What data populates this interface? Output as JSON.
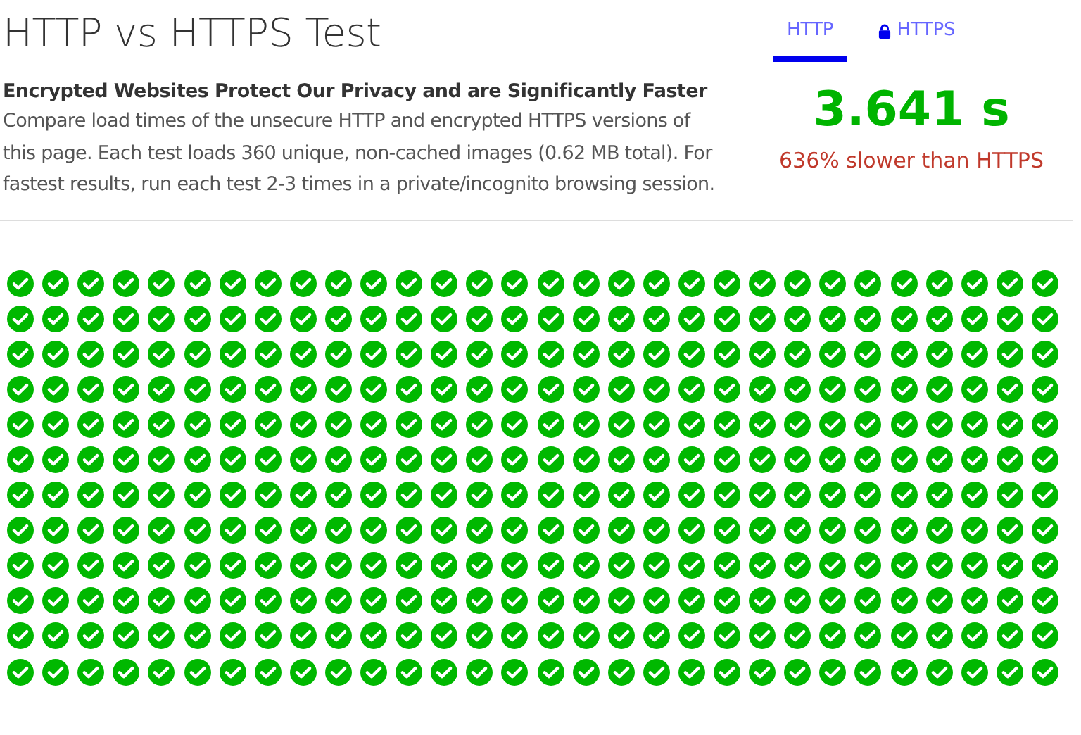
{
  "title": "HTTP vs HTTPS Test",
  "intro": {
    "heading": "Encrypted Websites Protect Our Privacy and are Significantly Faster",
    "body": "Compare load times of the unsecure HTTP and encrypted HTTPS versions of this page. Each test loads 360 unique, non-cached images (0.62 MB total). For fastest results, run each test 2-3 times in a private/incognito browsing session."
  },
  "tabs": [
    {
      "label": "HTTP",
      "kind": "plain",
      "selected": true
    },
    {
      "label": "HTTPS",
      "kind": "secure",
      "selected": false
    }
  ],
  "result": {
    "time": "3.641 s",
    "comparison": "636% slower than HTTPS"
  },
  "image_rows": [
    {
      "loaded": [
        true,
        true,
        true,
        true,
        true,
        true,
        true,
        true,
        true,
        true,
        true,
        true,
        true,
        true,
        true,
        true,
        true,
        true,
        true,
        true,
        true,
        true,
        true,
        true,
        true,
        true,
        true,
        true,
        true,
        true
      ]
    },
    {
      "loaded": [
        true,
        true,
        true,
        true,
        true,
        true,
        true,
        true,
        true,
        true,
        true,
        true,
        true,
        true,
        true,
        true,
        true,
        true,
        true,
        true,
        true,
        true,
        true,
        true,
        true,
        true,
        true,
        true,
        true,
        true
      ]
    },
    {
      "loaded": [
        true,
        true,
        true,
        true,
        true,
        true,
        true,
        true,
        true,
        true,
        true,
        true,
        true,
        true,
        true,
        true,
        true,
        true,
        true,
        true,
        true,
        true,
        true,
        true,
        true,
        true,
        true,
        true,
        true,
        true
      ]
    },
    {
      "loaded": [
        true,
        true,
        true,
        true,
        true,
        true,
        true,
        true,
        true,
        true,
        true,
        true,
        true,
        true,
        true,
        true,
        true,
        true,
        true,
        true,
        true,
        true,
        true,
        true,
        true,
        true,
        true,
        true,
        true,
        true
      ]
    },
    {
      "loaded": [
        true,
        true,
        true,
        true,
        true,
        true,
        true,
        true,
        true,
        true,
        true,
        true,
        true,
        true,
        true,
        true,
        true,
        true,
        true,
        true,
        true,
        true,
        true,
        true,
        true,
        true,
        true,
        true,
        true,
        true
      ]
    },
    {
      "loaded": [
        true,
        true,
        true,
        true,
        true,
        true,
        true,
        true,
        true,
        true,
        true,
        true,
        true,
        true,
        true,
        true,
        true,
        true,
        true,
        true,
        true,
        true,
        true,
        true,
        true,
        true,
        true,
        true,
        true,
        true
      ]
    },
    {
      "loaded": [
        true,
        true,
        true,
        true,
        true,
        true,
        true,
        true,
        true,
        true,
        true,
        true,
        true,
        true,
        true,
        true,
        true,
        true,
        true,
        true,
        true,
        true,
        true,
        true,
        true,
        true,
        true,
        true,
        true,
        true
      ]
    },
    {
      "loaded": [
        true,
        true,
        true,
        true,
        true,
        true,
        true,
        true,
        true,
        true,
        true,
        true,
        true,
        true,
        true,
        true,
        true,
        true,
        true,
        true,
        true,
        true,
        true,
        true,
        true,
        true,
        true,
        true,
        true,
        true
      ]
    },
    {
      "loaded": [
        true,
        true,
        true,
        true,
        true,
        true,
        true,
        true,
        true,
        true,
        true,
        true,
        true,
        true,
        true,
        true,
        true,
        true,
        true,
        true,
        true,
        true,
        true,
        true,
        true,
        true,
        true,
        true,
        true,
        true
      ]
    },
    {
      "loaded": [
        true,
        true,
        true,
        true,
        true,
        true,
        true,
        true,
        true,
        true,
        true,
        true,
        true,
        true,
        true,
        true,
        true,
        true,
        true,
        true,
        true,
        true,
        true,
        true,
        true,
        true,
        true,
        true,
        true,
        true
      ]
    },
    {
      "loaded": [
        true,
        true,
        true,
        true,
        true,
        true,
        true,
        true,
        true,
        true,
        true,
        true,
        true,
        true,
        true,
        true,
        true,
        true,
        true,
        true,
        true,
        true,
        true,
        true,
        true,
        true,
        true,
        true,
        true,
        true
      ]
    },
    {
      "loaded": [
        true,
        true,
        true,
        true,
        true,
        true,
        true,
        true,
        true,
        true,
        true,
        true,
        true,
        true,
        true,
        true,
        true,
        true,
        true,
        true,
        true,
        true,
        true,
        true,
        true,
        true,
        true,
        true,
        true,
        true
      ]
    }
  ]
}
